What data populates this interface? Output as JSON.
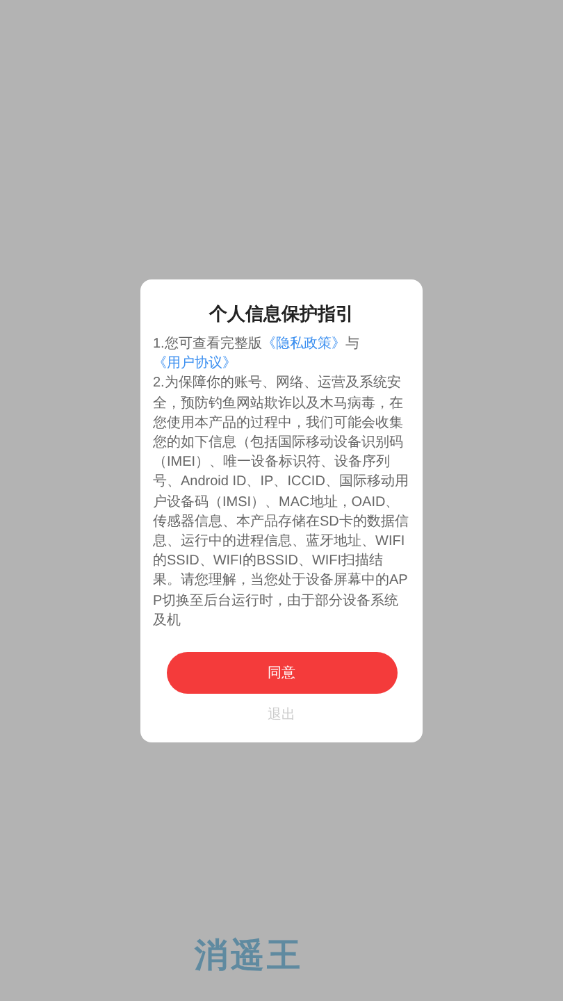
{
  "background": {
    "logo_text": "消遥王"
  },
  "dialog": {
    "title": "个人信息保护指引",
    "paragraphs": [
      {
        "parts": [
          {
            "kind": "text",
            "text": "1.您可查看完整版"
          },
          {
            "kind": "link",
            "text": "《隐私政策》"
          },
          {
            "kind": "text",
            "text": "与"
          },
          {
            "kind": "link",
            "text": "《用户协议》"
          }
        ]
      },
      {
        "parts": [
          {
            "kind": "text",
            "text": "2.为保障你的账号、网络、运营及系统安全，预防钓鱼网站欺诈以及木马病毒，在您使用本产品的过程中，我们可能会收集您的如下信息（包括国际移动设备识别码（IMEI）、唯一设备标识符、设备序列号、Android ID、IP、ICCID、国际移动用户设备码（IMSI）、MAC地址，OAID、传感器信息、本产品存储在SD卡的数据信息、运行中的进程信息、蓝牙地址、WIFI的SSID、WIFI的BSSID、WIFI扫描结果。请您理解，当您处于设备屏幕中的APP切换至后台运行时，由于部分设备系统及机"
          }
        ]
      }
    ],
    "agree_button": "同意",
    "exit_button": "退出"
  }
}
